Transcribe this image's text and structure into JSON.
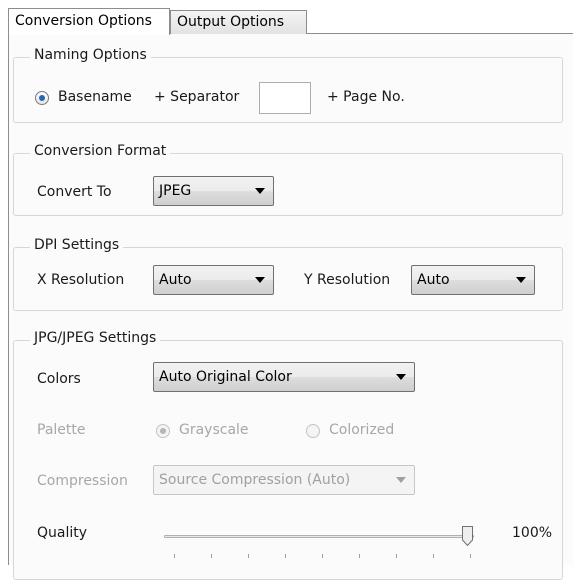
{
  "tabs": [
    {
      "label": "Conversion Options",
      "active": true
    },
    {
      "label": "Output Options",
      "active": false
    }
  ],
  "naming": {
    "title": "Naming Options",
    "basename_label": "Basename",
    "basename_selected": true,
    "separator_label": "+ Separator",
    "separator_value": "",
    "pageno_label": "+ Page No."
  },
  "conversion": {
    "title": "Conversion Format",
    "convert_to_label": "Convert To",
    "convert_to_value": "JPEG"
  },
  "dpi": {
    "title": "DPI Settings",
    "x_label": "X Resolution",
    "x_value": "Auto",
    "y_label": "Y Resolution",
    "y_value": "Auto"
  },
  "jpeg": {
    "title": "JPG/JPEG Settings",
    "colors_label": "Colors",
    "colors_value": "Auto Original Color",
    "palette_label": "Palette",
    "grayscale_label": "Grayscale",
    "grayscale_selected": true,
    "colorized_label": "Colorized",
    "compression_label": "Compression",
    "compression_value": "Source Compression (Auto)",
    "quality_label": "Quality",
    "quality_text": "100%",
    "quality_value": 1.0
  },
  "colors": {
    "radio_dot": "#2a63b8",
    "disabled_text": "#a7a7a7",
    "group_border": "#d6d6d6"
  }
}
